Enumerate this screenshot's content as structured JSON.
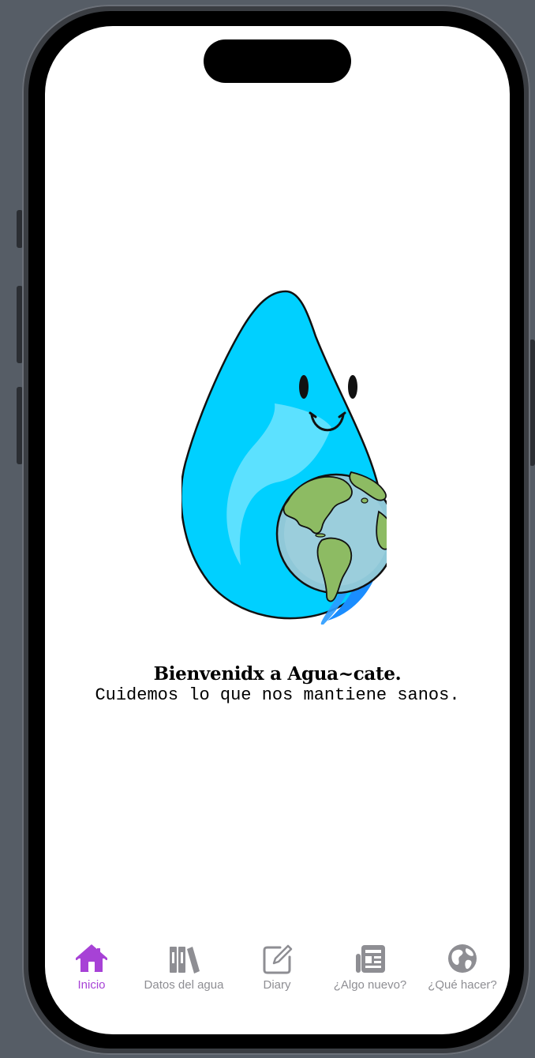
{
  "welcome": {
    "title": "Bienvenidx a Agua~cate.",
    "subtitle": "Cuidemos lo que nos mantiene sanos."
  },
  "mascot": {
    "description_icon": "water-drop-earth-mascot-icon"
  },
  "tabbar": {
    "items": [
      {
        "label": "Inicio",
        "icon": "house-icon",
        "active": true
      },
      {
        "label": "Datos del agua",
        "icon": "books-icon",
        "active": false
      },
      {
        "label": "Diary",
        "icon": "square-pencil-icon",
        "active": false
      },
      {
        "label": "¿Algo nuevo?",
        "icon": "newspaper-icon",
        "active": false
      },
      {
        "label": "¿Qué hacer?",
        "icon": "globe-icon",
        "active": false
      }
    ]
  },
  "colors": {
    "accent": "#a742d6",
    "inactive_tab": "#8e8e93",
    "drop": "#00cfff",
    "background": "#ffffff"
  }
}
